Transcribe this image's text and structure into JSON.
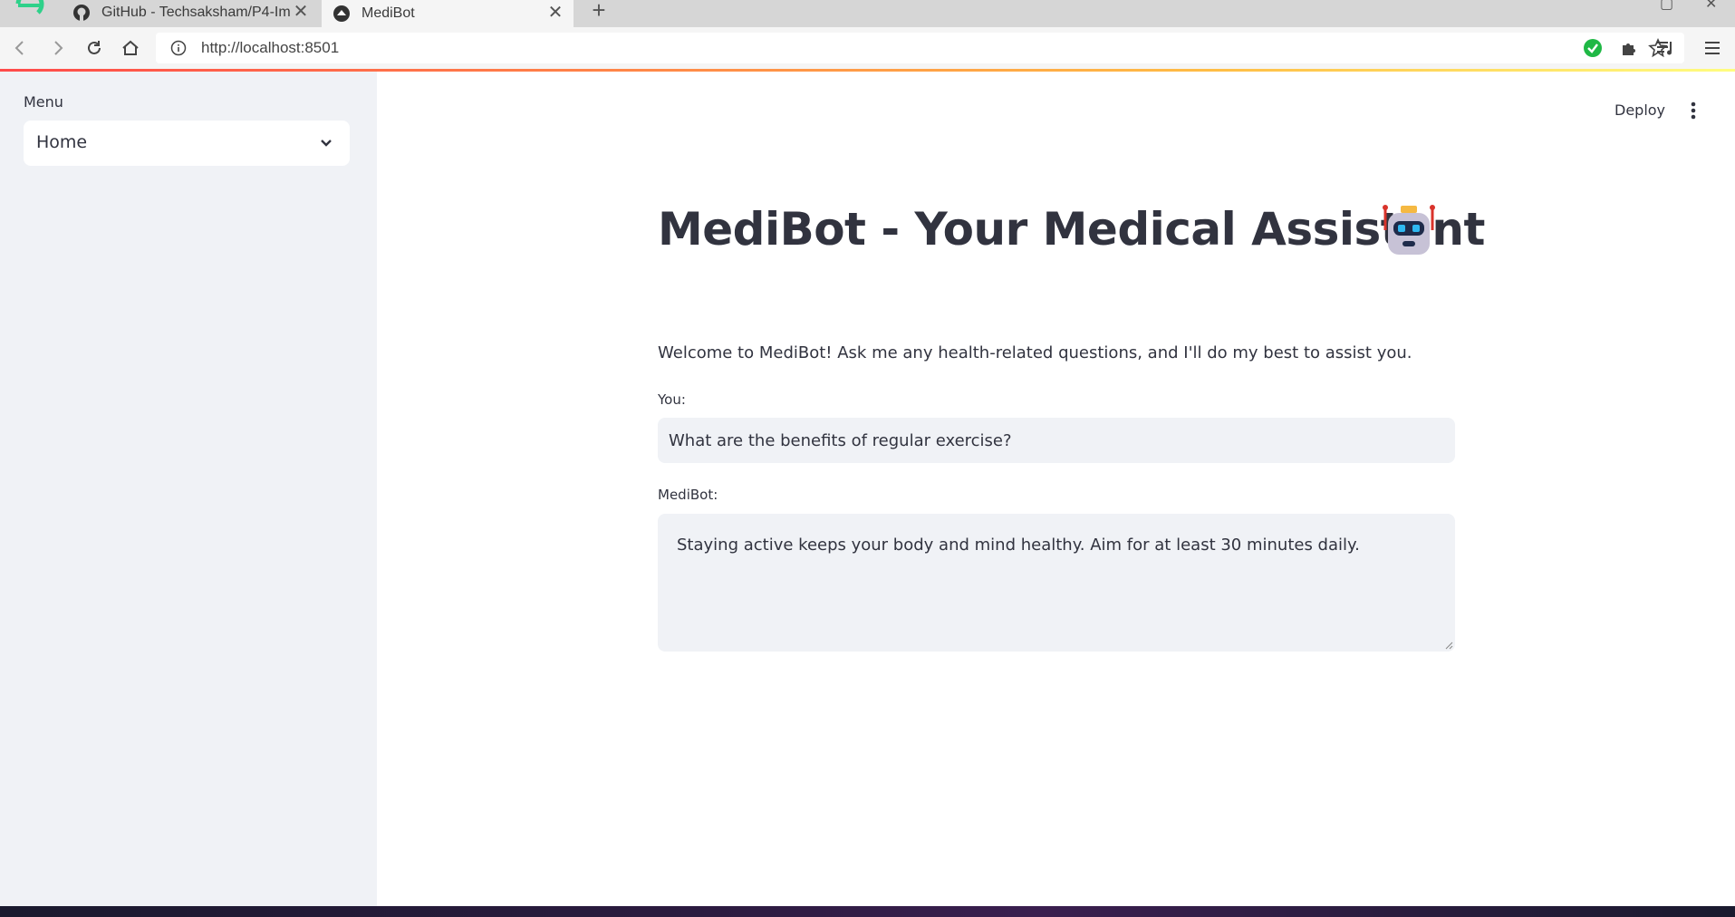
{
  "browser": {
    "tabs": [
      {
        "title": "GitHub - Techsaksham/P4-Im",
        "icon": "github-icon"
      },
      {
        "title": "MediBot",
        "icon": "streamlit-icon"
      }
    ],
    "url": "http://localhost:8501"
  },
  "sidebar": {
    "menu_label": "Menu",
    "selected": "Home"
  },
  "header": {
    "deploy_label": "Deploy"
  },
  "main": {
    "title": "MediBot - Your Medical Assistant",
    "title_icon": "robot-icon",
    "welcome": "Welcome to MediBot! Ask me any health-related questions, and I'll do my best to assist you.",
    "you_label": "You:",
    "you_value": "What are the benefits of regular exercise?",
    "bot_label": "MediBot:",
    "bot_response": "Staying active keeps your body and mind healthy. Aim for at least 30 minutes daily."
  },
  "colors": {
    "accent": "#ff4b4b",
    "text": "#31333f",
    "sidebar_bg": "#f0f2f6"
  }
}
